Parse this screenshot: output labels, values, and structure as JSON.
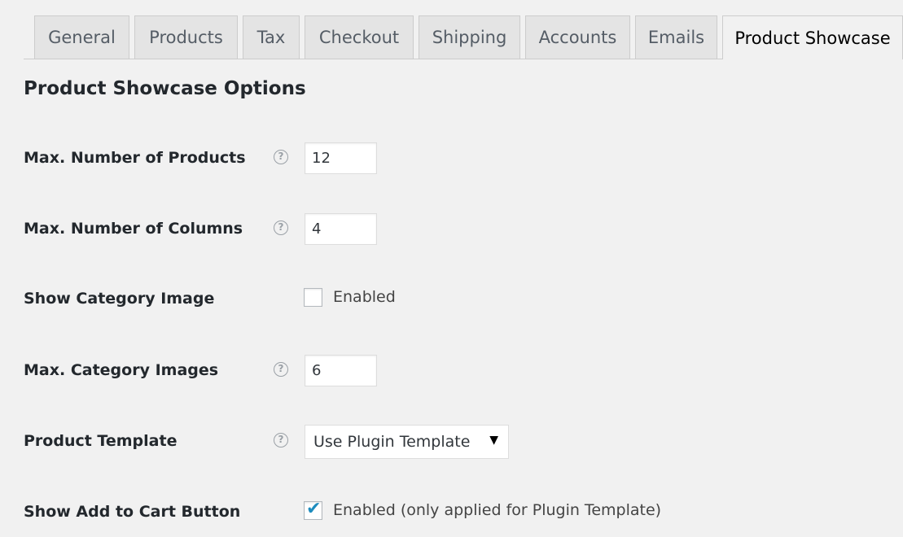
{
  "tabs": [
    {
      "label": "General"
    },
    {
      "label": "Products"
    },
    {
      "label": "Tax"
    },
    {
      "label": "Checkout"
    },
    {
      "label": "Shipping"
    },
    {
      "label": "Accounts"
    },
    {
      "label": "Emails"
    },
    {
      "label": "Product Showcase",
      "active": true
    }
  ],
  "section_title": "Product Showcase Options",
  "fields": {
    "max_products": {
      "label": "Max. Number of Products",
      "value": "12",
      "help_icon": "question-circle"
    },
    "max_columns": {
      "label": "Max. Number of Columns",
      "value": "4",
      "help_icon": "question-circle"
    },
    "show_category_image": {
      "label": "Show Category Image",
      "checkbox_label": "Enabled",
      "checked": false
    },
    "max_category_images": {
      "label": "Max. Category Images",
      "value": "6",
      "help_icon": "question-circle"
    },
    "product_template": {
      "label": "Product Template",
      "selected": "Use Plugin Template",
      "help_icon": "question-circle"
    },
    "show_add_to_cart": {
      "label": "Show Add to Cart Button",
      "checkbox_label": "Enabled (only applied for Plugin Template)",
      "checked": true
    }
  },
  "colors": {
    "accent": "#1e8cbe",
    "background": "#f1f1f1",
    "tab_bg": "#e4e4e4"
  }
}
